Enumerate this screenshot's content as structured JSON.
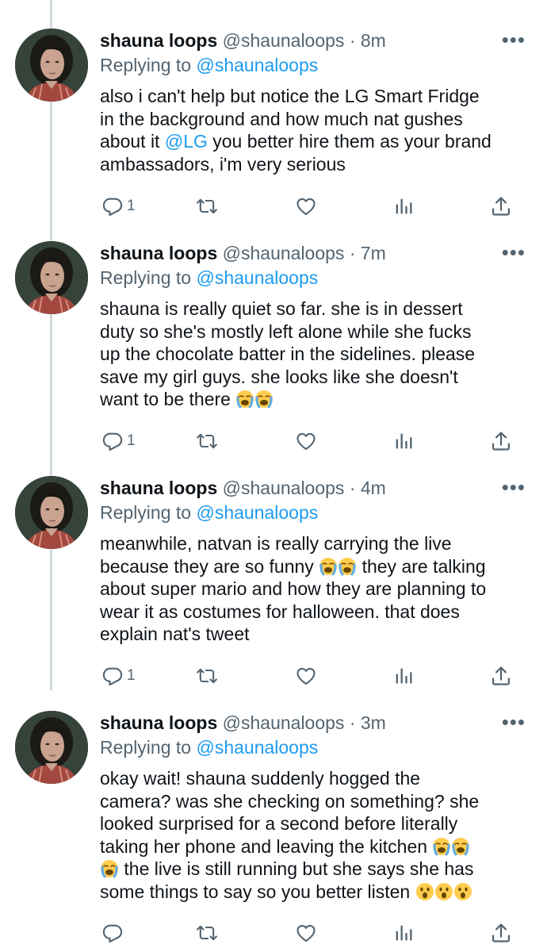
{
  "tweets": [
    {
      "name": "shauna loops",
      "handle": "@shaunaloops",
      "time": "8m",
      "replying_label": "Replying to",
      "replying_to": "@shaunaloops",
      "body_lines": [
        "also i can't help but notice the LG Smart Fridge",
        "in the background and how much nat gushes",
        "about it ",
        "ambassadors, i'm very serious"
      ],
      "mention_inline": "@LG",
      "mention_tail": " you better hire them as your brand",
      "reply_count": "1"
    },
    {
      "name": "shauna loops",
      "handle": "@shaunaloops",
      "time": "7m",
      "replying_label": "Replying to",
      "replying_to": "@shaunaloops",
      "body_lines": [
        "shauna is really quiet so far. she is in dessert",
        "duty so she's mostly left alone while she fucks",
        "up the chocolate batter in the sidelines. please",
        "save my girl guys. she looks like she doesn't",
        "want to be there "
      ],
      "reply_count": "1"
    },
    {
      "name": "shauna loops",
      "handle": "@shaunaloops",
      "time": "4m",
      "replying_label": "Replying to",
      "replying_to": "@shaunaloops",
      "body_lines": [
        "meanwhile, natvan is really carrying the live",
        "because they are so funny ",
        " they are talking",
        "about super mario and how they are planning to",
        "wear it as costumes for halloween. that does",
        "explain nat's tweet"
      ],
      "reply_count": "1"
    },
    {
      "name": "shauna loops",
      "handle": "@shaunaloops",
      "time": "3m",
      "replying_label": "Replying to",
      "replying_to": "@shaunaloops",
      "body_lines": [
        "okay wait! shauna suddenly hogged the",
        "camera? was she checking on something? she",
        "looked surprised for a second before literally",
        "taking her phone and leaving the kitchen ",
        " the live is still running but she says she has",
        "some things to say so you better listen "
      ],
      "reply_count": ""
    }
  ],
  "separator": "·",
  "more_glyph": "•••",
  "icons": {
    "reply": "reply-icon",
    "retweet": "retweet-icon",
    "like": "heart-icon",
    "analytics": "analytics-icon",
    "share": "share-icon",
    "more": "more-icon",
    "crying_emoji": "loudly-crying-face-emoji",
    "surprised_emoji": "astonished-face-emoji"
  },
  "colors": {
    "link": "#1d9bf0",
    "muted": "#536471",
    "text": "#0f1419",
    "thread_line": "#cfd9de"
  }
}
